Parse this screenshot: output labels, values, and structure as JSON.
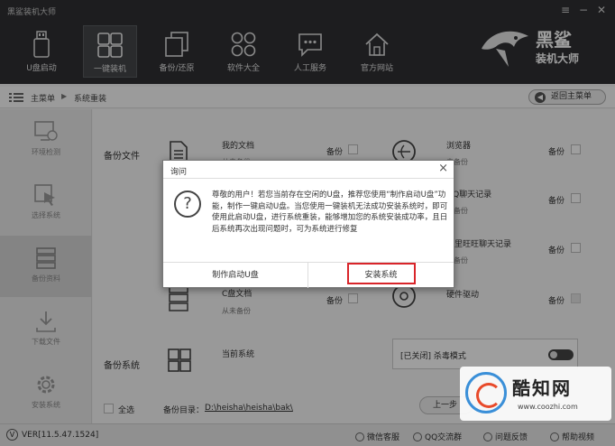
{
  "window": {
    "title": "黑鲨装机大师",
    "controls": [
      "menu-icon",
      "minimize-icon",
      "close-icon"
    ]
  },
  "toolbar": {
    "items": [
      {
        "label": "U盘启动",
        "icon": "usb-drive-icon"
      },
      {
        "label": "一键装机",
        "icon": "windows-icon",
        "active": true
      },
      {
        "label": "备份/还原",
        "icon": "backup-restore-icon"
      },
      {
        "label": "软件大全",
        "icon": "app-grid-icon"
      },
      {
        "label": "人工服务",
        "icon": "chat-bubble-icon"
      },
      {
        "label": "官方网站",
        "icon": "home-icon"
      }
    ],
    "brand": {
      "line1": "黑鲨",
      "line2": "装机大师",
      "icon": "shark-logo-icon"
    }
  },
  "breadcrumb": {
    "root": "主菜单",
    "current": "系统重装",
    "back_label": "返回主菜单"
  },
  "sidebar": {
    "items": [
      {
        "label": "环境检测",
        "icon": "monitor-check-icon"
      },
      {
        "label": "选择系统",
        "icon": "cursor-select-icon"
      },
      {
        "label": "备份资料",
        "icon": "server-backup-icon",
        "active": true
      },
      {
        "label": "下载文件",
        "icon": "download-icon"
      },
      {
        "label": "安装系统",
        "icon": "gear-icon"
      }
    ]
  },
  "backup": {
    "files_label": "备份文件",
    "left_items": [
      {
        "title": "我的文档",
        "status": "从未备份",
        "check_label": "备份"
      },
      {
        "title": "C盘文档",
        "status": "从未备份",
        "check_label": "备份"
      }
    ],
    "right_items": [
      {
        "title": "浏览器",
        "status": "未备份",
        "check_label": "备份"
      },
      {
        "title": "QQ聊天记录",
        "status": "未备份",
        "check_label": "备份"
      },
      {
        "title": "阿里旺旺聊天记录",
        "status": "未备份",
        "check_label": "备份"
      },
      {
        "title": "硬件驱动",
        "status": "",
        "check_label": "备份"
      }
    ],
    "system_label": "备份系统",
    "current_system": "当前系统",
    "antivirus_mode": "[已关闭] 杀毒模式",
    "select_all": "全选",
    "dir_label": "备份目录：",
    "dir_path": "D:\\heisha\\heisha\\bak\\",
    "prev_button": "上一步"
  },
  "statusbar": {
    "version": "VER[11.5.47.1524]",
    "links": [
      "微信客服",
      "QQ交流群",
      "问题反馈",
      "帮助视频"
    ]
  },
  "dialog": {
    "title": "询问",
    "message": "尊敬的用户！若您当前存在空闲的U盘，推荐您使用“制作启动U盘”功能，制作一键启动U盘。当您使用一键装机无法成功安装系统时，即可使用此启动U盘，进行系统重装，能够增加您的系统安装成功率，且日后系统再次出现问题时，可为系统进行修复",
    "buttons": [
      "制作启动U盘",
      "安装系统"
    ]
  },
  "watermark": {
    "name": "酷知网",
    "url": "www.coozhi.com"
  },
  "colors": {
    "toolbar_bg": "#2f3033",
    "highlight_red": "#d9252a"
  }
}
